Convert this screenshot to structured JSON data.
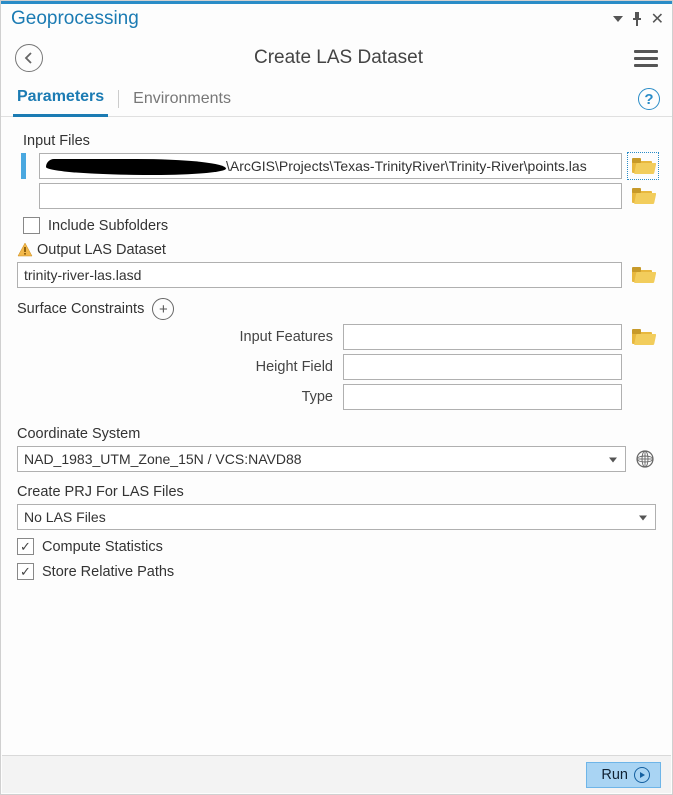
{
  "titlebar": {
    "title": "Geoprocessing"
  },
  "toolbar": {
    "title": "Create LAS Dataset"
  },
  "tabs": {
    "parameters": "Parameters",
    "environments": "Environments"
  },
  "labels": {
    "input_files": "Input Files",
    "include_subfolders": "Include Subfolders",
    "output_las_dataset": "Output LAS Dataset",
    "surface_constraints": "Surface Constraints",
    "input_features": "Input Features",
    "height_field": "Height Field",
    "type": "Type",
    "coordinate_system": "Coordinate System",
    "create_prj": "Create PRJ For LAS Files",
    "compute_statistics": "Compute Statistics",
    "store_relative_paths": "Store Relative Paths"
  },
  "values": {
    "input_file_1_suffix": "\\ArcGIS\\Projects\\Texas-TrinityRiver\\Trinity-River\\points.las",
    "input_file_2": "",
    "output_las_dataset": "trinity-river-las.lasd",
    "input_features": "",
    "height_field": "",
    "type": "",
    "coordinate_system": "NAD_1983_UTM_Zone_15N / VCS:NAVD88",
    "create_prj": "No LAS Files"
  },
  "checks": {
    "include_subfolders": false,
    "compute_statistics": true,
    "store_relative_paths": true
  },
  "footer": {
    "run": "Run"
  }
}
